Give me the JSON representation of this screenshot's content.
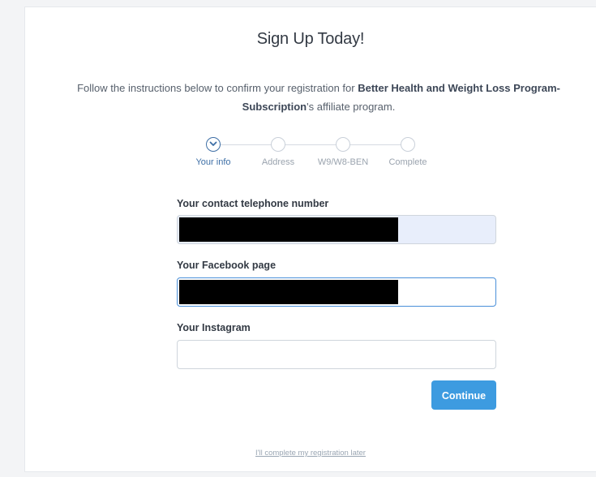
{
  "header": {
    "title": "Sign Up Today!"
  },
  "intro": {
    "before": "Follow the instructions below to confirm your registration for ",
    "program_name": "Better Health and Weight Loss Program-Subscription",
    "after": "'s affiliate program."
  },
  "stepper": {
    "steps": [
      {
        "label": "Your info",
        "state": "active"
      },
      {
        "label": "Address",
        "state": "pending"
      },
      {
        "label": "W9/W8-BEN",
        "state": "pending"
      },
      {
        "label": "Complete",
        "state": "pending"
      }
    ]
  },
  "form": {
    "telephone": {
      "label": "Your contact telephone number",
      "value": "",
      "redacted": true
    },
    "facebook": {
      "label": "Your Facebook page",
      "value": "",
      "redacted": true
    },
    "instagram": {
      "label": "Your Instagram",
      "value": "",
      "placeholder": ""
    },
    "continue_label": "Continue"
  },
  "footer": {
    "later_link": "I'll complete my registration later"
  },
  "colors": {
    "accent": "#3d9be0",
    "active_step": "#3e6fa6",
    "filled_input_bg": "#e8eefb"
  }
}
